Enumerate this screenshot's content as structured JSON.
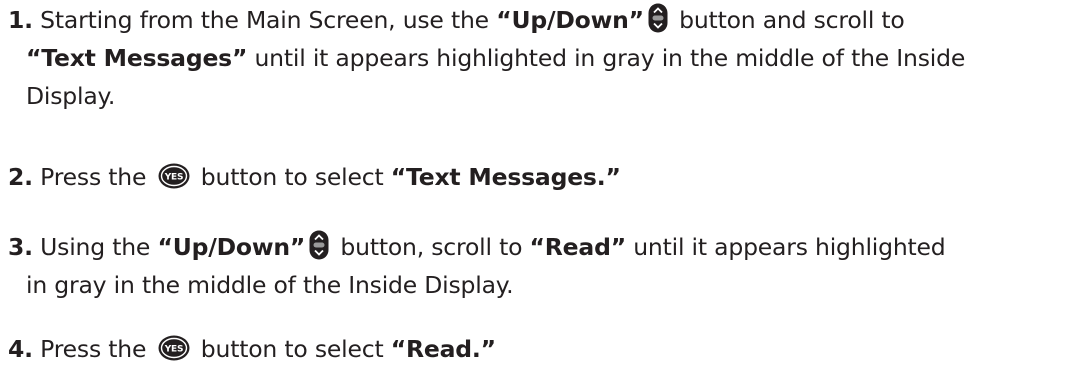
{
  "steps": [
    {
      "number": "1.",
      "line1": {
        "t1": "Starting from the ",
        "b1": "Main Screen",
        "t2": ", use the ",
        "b2": "“Up/Down”",
        "t3": " button and scroll to"
      },
      "line2": {
        "b1": "“Text Messages”",
        "t1": " until it appears highlighted in gray in the middle of the Inside"
      },
      "line3": {
        "t1": "Display."
      },
      "icon": "up-down-button-icon"
    },
    {
      "number": "2.",
      "line1": {
        "t1": "Press the ",
        "t2": " button to select ",
        "b1": "“Text Messages.”"
      },
      "icon": "yes-button-icon",
      "icon_label": "YES"
    },
    {
      "number": "3.",
      "line1": {
        "t1": "Using the ",
        "b1": "“Up/Down”",
        "t2": " button, scroll to ",
        "b2": "“Read”",
        "t3": " until it appears highlighted"
      },
      "line2": {
        "t1": "in gray in the middle of the Inside Display."
      },
      "icon": "up-down-button-icon"
    },
    {
      "number": "4.",
      "line1": {
        "t1": "Press the ",
        "t2": " button to select ",
        "b1": "“Read.”"
      },
      "icon": "yes-button-icon",
      "icon_label": "YES"
    }
  ]
}
